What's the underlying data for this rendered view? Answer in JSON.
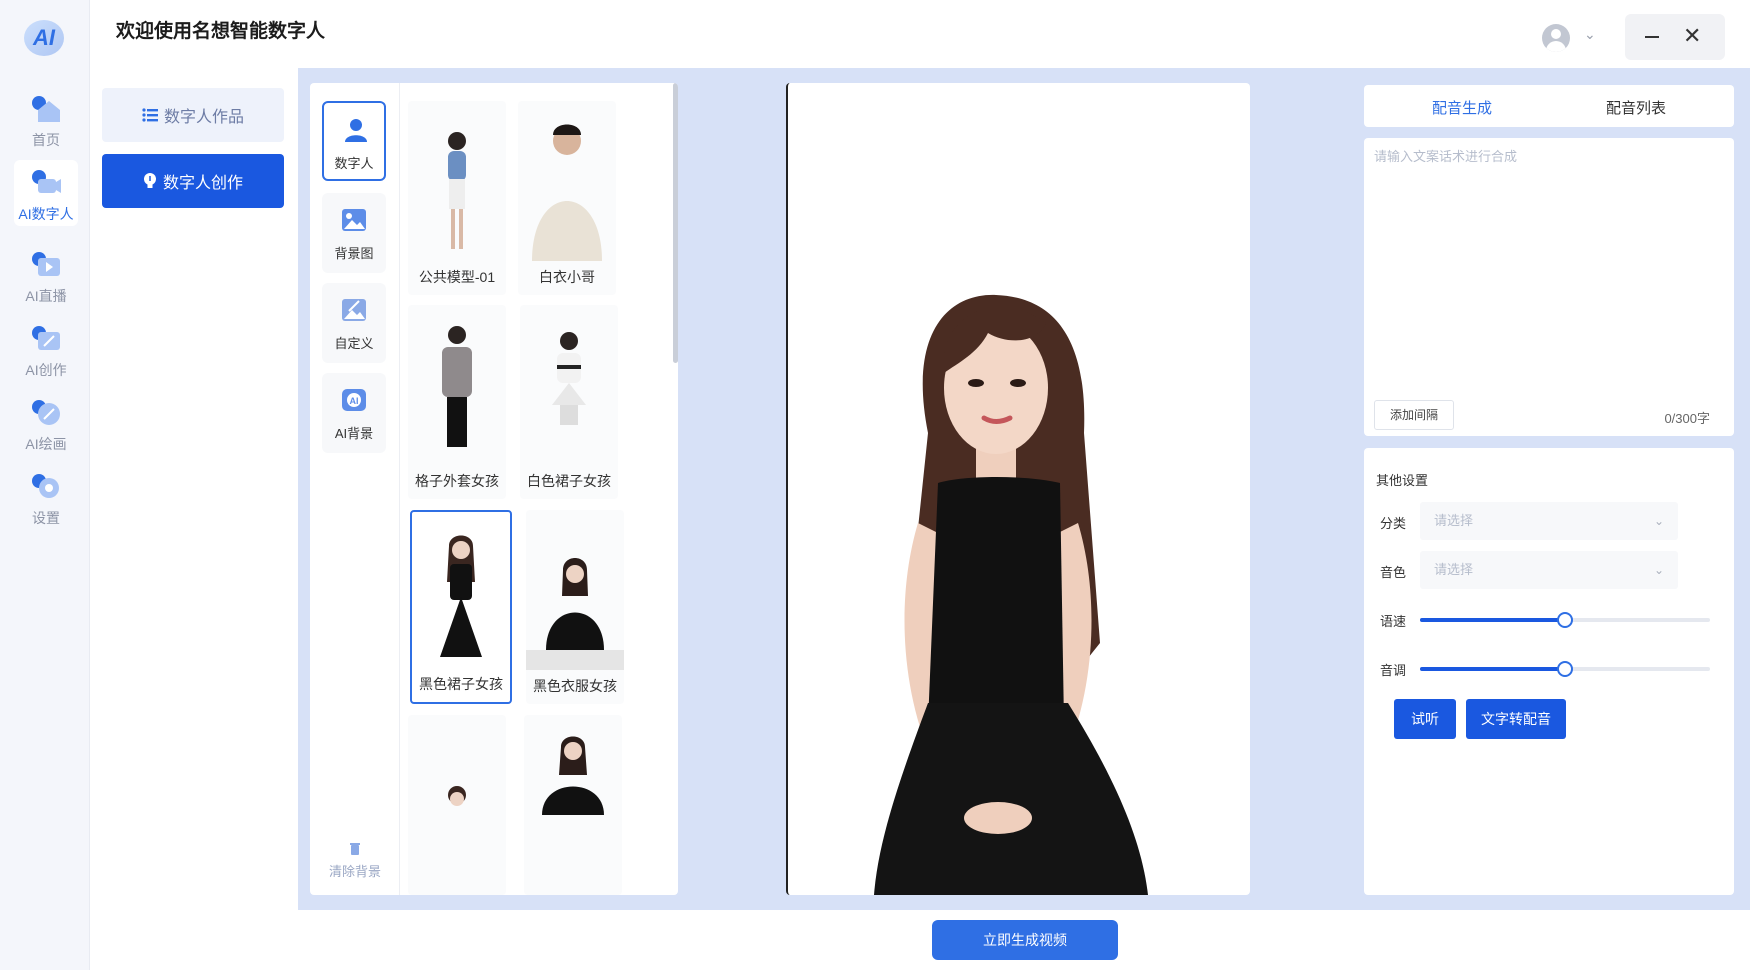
{
  "app": {
    "title": "欢迎使用名想智能数字人",
    "logo_text": "AI"
  },
  "rail": {
    "items": [
      {
        "label": "首页",
        "icon": "home-icon"
      },
      {
        "label": "AI数字人",
        "icon": "camera-icon",
        "active": true
      },
      {
        "label": "AI直播",
        "icon": "live-icon"
      },
      {
        "label": "AI创作",
        "icon": "edit-icon"
      },
      {
        "label": "AI绘画",
        "icon": "paint-icon"
      },
      {
        "label": "设置",
        "icon": "gear-icon"
      }
    ]
  },
  "subnav": {
    "works": "数字人作品",
    "create": "数字人创作"
  },
  "categories": [
    {
      "label": "数字人",
      "active": true
    },
    {
      "label": "背景图"
    },
    {
      "label": "自定义"
    },
    {
      "label": "AI背景"
    }
  ],
  "clear_bg": "清除背景",
  "avatars": [
    {
      "name": "公共模型-01"
    },
    {
      "name": "白衣小哥"
    },
    {
      "name": "格子外套女孩"
    },
    {
      "name": "白色裙子女孩"
    },
    {
      "name": "黑色裙子女孩",
      "selected": true
    },
    {
      "name": "黑色衣服女孩"
    },
    {
      "name": ""
    },
    {
      "name": ""
    }
  ],
  "tts": {
    "tab_generate": "配音生成",
    "tab_list": "配音列表",
    "placeholder": "请输入文案话术进行合成",
    "add_interval": "添加间隔",
    "counter": "0/300字",
    "other_settings": "其他设置",
    "category_label": "分类",
    "category_placeholder": "请选择",
    "voice_label": "音色",
    "voice_placeholder": "请选择",
    "speed_label": "语速",
    "speed_value": 0.5,
    "pitch_label": "音调",
    "pitch_value": 0.5,
    "listen": "试听",
    "convert": "文字转配音"
  },
  "generate_video": "立即生成视频",
  "colors": {
    "accent": "#2f6fe4",
    "primary_button": "#1a58e0",
    "main_bg": "#d7e1f7"
  }
}
